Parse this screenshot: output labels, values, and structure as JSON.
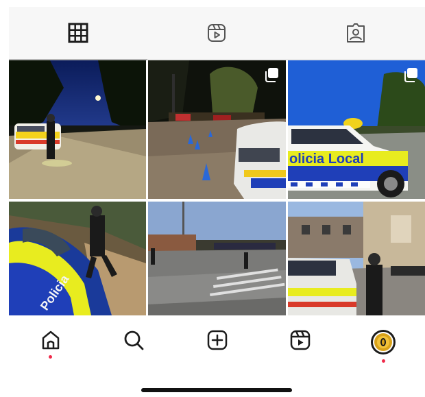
{
  "colors": {
    "icon": "#1c1c1c",
    "notification_dot": "#ef2a4a",
    "tabbar_bg": "#f7f7f7",
    "police_yellow": "#e8ec1f",
    "police_blue": "#1f3fb8"
  },
  "tabs": [
    {
      "icon": "grid-icon",
      "active": true
    },
    {
      "icon": "reels-icon",
      "active": false
    },
    {
      "icon": "tagged-icon",
      "active": false
    }
  ],
  "grid": {
    "posts": [
      {
        "multi": false
      },
      {
        "multi": true
      },
      {
        "multi": true,
        "overlay_text": "olicia Local"
      },
      {
        "multi": false,
        "overlay_text": "Policia"
      },
      {
        "multi": false
      },
      {
        "multi": false
      }
    ]
  },
  "bottom_nav": [
    {
      "icon": "home-icon",
      "notification": true
    },
    {
      "icon": "search-icon",
      "notification": false
    },
    {
      "icon": "create-icon",
      "notification": false
    },
    {
      "icon": "reels-icon",
      "notification": false
    },
    {
      "icon": "profile-avatar-icon",
      "notification": true
    }
  ]
}
